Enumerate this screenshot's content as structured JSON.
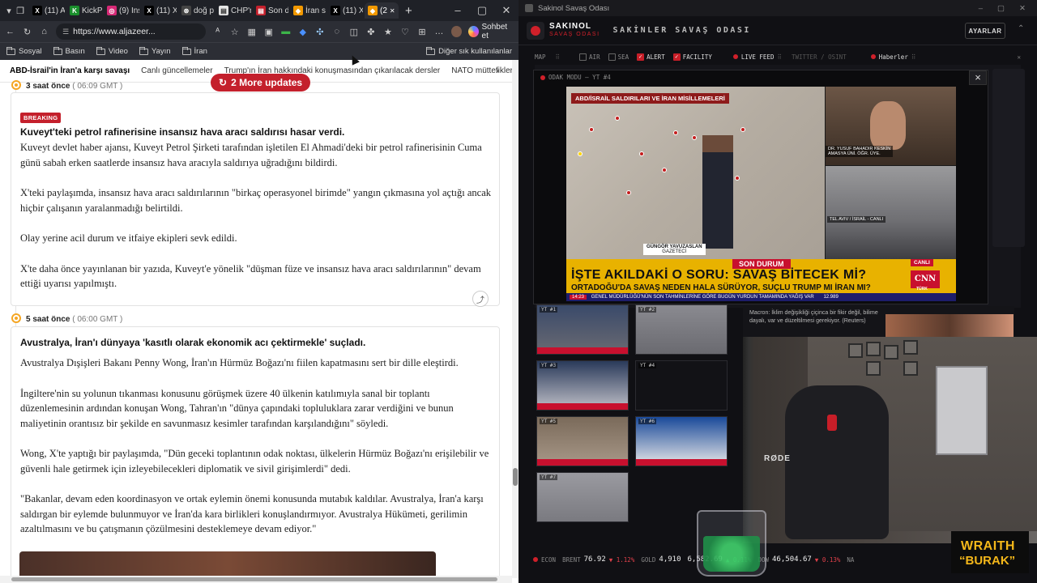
{
  "browser": {
    "tabs": [
      {
        "favicon": "X",
        "color": "#000000",
        "label": "(11) A"
      },
      {
        "favicon": "K",
        "color": "#1a8f2c",
        "label": "KickPr"
      },
      {
        "favicon": "◎",
        "color": "#d62976",
        "label": "(9) Ins"
      },
      {
        "favicon": "X",
        "color": "#000000",
        "label": "(11) X"
      },
      {
        "favicon": "⊛",
        "color": "#444444",
        "label": "doğ p"
      },
      {
        "favicon": "▤",
        "color": "#e5e5e5",
        "label": "CHP'n"
      },
      {
        "favicon": "▤",
        "color": "#c4202c",
        "label": "Son d"
      },
      {
        "favicon": "◆",
        "color": "#f29900",
        "label": "İran s"
      },
      {
        "favicon": "X",
        "color": "#000000",
        "label": "(11) X"
      },
      {
        "favicon": "◆",
        "color": "#f29900",
        "label": "(2"
      }
    ],
    "new_tab": "+",
    "url": "https://www.aljazeer...",
    "chat_label": "Sohbet et",
    "bookmarks": [
      "Sosyal",
      "Basın",
      "Video",
      "Yayın",
      "İran"
    ],
    "other_bookmarks": "Diğer sık kullanılanlar"
  },
  "page": {
    "nav": [
      "ABD-İsrail'in İran'a karşı savaşı",
      "Canlı güncellemeler",
      "Trump'ın İran hakkındaki konuşmasından çıkarılacak dersler",
      "NATO müttefikleri Trump"
    ],
    "updates_button": "2 More updates",
    "entry1": {
      "time_rel": "3 saat önce",
      "time_abs": "( 06:09 GMT )",
      "badge": "BREAKING",
      "headline": "Kuveyt'teki petrol rafinerisine insansız hava aracı saldırısı hasar verdi.",
      "paragraphs": [
        "Kuveyt devlet haber ajansı, Kuveyt Petrol Şirketi tarafından işletilen El Ahmadi'deki bir petrol rafinerisinin Cuma günü sabah erken saatlerde insansız hava aracıyla saldırıya uğradığını bildirdi.",
        "X'teki paylaşımda, insansız hava aracı saldırılarının \"birkaç operasyonel birimde\" yangın çıkmasına yol açtığı ancak hiçbir çalışanın yaralanmadığı belirtildi.",
        "Olay yerine acil durum ve itfaiye ekipleri sevk edildi.",
        "X'te daha önce yayınlanan bir yazıda, Kuveyt'e yönelik \"düşman füze ve insansız hava aracı saldırılarının\" devam ettiği uyarısı yapılmıştı."
      ]
    },
    "entry2": {
      "time_rel": "5 saat önce",
      "time_abs": "( 06:00 GMT )",
      "headline": "Avustralya, İran'ı dünyaya 'kasıtlı olarak ekonomik acı çektirmekle' suçladı.",
      "paragraphs": [
        "Avustralya Dışişleri Bakanı Penny Wong, İran'ın Hürmüz Boğazı'nı fiilen kapatmasını sert bir dille eleştirdi.",
        "İngiltere'nin su yolunun tıkanması konusunu görüşmek üzere 40 ülkenin katılımıyla sanal bir toplantı düzenlemesinin ardından konuşan Wong, Tahran'ın \"dünya çapındaki topluluklara zarar verdiğini ve bunun maliyetinin orantısız bir şekilde en savunmasız kesimler tarafından karşılandığını\" söyledi.",
        "Wong, X'te yaptığı bir paylaşımda, \"Dün geceki toplantının odak noktası, ülkelerin Hürmüz Boğazı'nı erişilebilir ve güvenli hale getirmek için izleyebilecekleri diplomatik ve sivil girişimlerdi\" dedi.",
        "\"Bakanlar, devam eden koordinasyon ve ortak eylemin önemi konusunda mutabık kaldılar. Avustralya, İran'a karşı saldırgan bir eylemde bulunmuyor ve İran'da kara birlikleri konuşlandırmıyor. Avustralya Hükümeti, gerilimin azaltılmasını ve bu çatışmanın çözülmesini desteklemeye devam ediyor.\""
      ]
    }
  },
  "dashboard": {
    "window_title": "Sakinol Savaş Odası",
    "brand_top": "SAKINOL",
    "brand_bottom": "SAVAŞ ODASI",
    "header_title": "SAKİNLER SAVAŞ ODASI",
    "settings_button": "AYARLAR",
    "map_label": "MAP",
    "layers": [
      {
        "label": "AIR",
        "on": false
      },
      {
        "label": "SEA",
        "on": false
      },
      {
        "label": "ALERT",
        "on": true
      },
      {
        "label": "FACILITY",
        "on": true
      }
    ],
    "live_feed": "LIVE FEED",
    "twitter": "TWITTER / OSINT",
    "news_label": "Haberler",
    "focus_mode": "ODAK MODU — YT #4",
    "video": {
      "map_title": "ABD/İSRAİL SALDIRILARI VE İRAN MİSİLLEMELERİ",
      "presenter_name": "GÜNGÖR YAVUZASLAN",
      "presenter_role": "GAZETECİ",
      "guest_caption": "DR. YUSUF BAHADIR KESKİN",
      "guest_role": "AMASYA ÜNİ. ÖĞR. ÜYE.",
      "location_caption": "TEL AVIV / İSRAİL - CANLI",
      "son_durum": "SON DURUM",
      "canli": "CANLI",
      "question": "İŞTE AKILDAKİ O SORU: SAVAŞ BİTECEK Mİ?",
      "sub": "ORTADOĞU'DA SAVAŞ NEDEN HALA SÜRÜYOR, SUÇLU TRUMP MI İRAN MI?",
      "channel": "CNN",
      "channel_sub": "TÜRK",
      "ticker_time": "14:23",
      "ticker": "GENEL MÜDÜRLÜĞÜ'NÜN SON TAHMİNLERİNE GÖRE BUGÜN YURDUN TAMAMINDA YAĞIŞ VAR",
      "ticker_value": "12.989"
    },
    "grid_labels": [
      "YT #1",
      "YT #2",
      "YT #3",
      "YT #4",
      "YT #5",
      "YT #6",
      "YT #7"
    ],
    "news_quote": "Macron: İklim değişikliği çiçinca bir fikir değil, bilime dayalı, var ve düzeltilmesi gerekiyor. (Reuters)",
    "cam_brand": "RØDE",
    "econ": [
      {
        "label": "ECON",
        "value": "",
        "change": "",
        "dir": ""
      },
      {
        "label": "BRENT",
        "value": "76.92",
        "change": "▼ 1.12%",
        "dir": "dn"
      },
      {
        "label": "GOLD",
        "value": "4,910",
        "change": "",
        "dir": ""
      },
      {
        "label": "",
        "value": "6,582.69",
        "change": "▲ 0.11%",
        "dir": "up"
      },
      {
        "label": "DOW",
        "value": "46,504.67",
        "change": "▼ 0.13%",
        "dir": "dn"
      },
      {
        "label": "NA",
        "value": "",
        "change": "",
        "dir": ""
      }
    ],
    "overlay_line1": "WRAITH",
    "overlay_line2": "“BURAK”"
  }
}
